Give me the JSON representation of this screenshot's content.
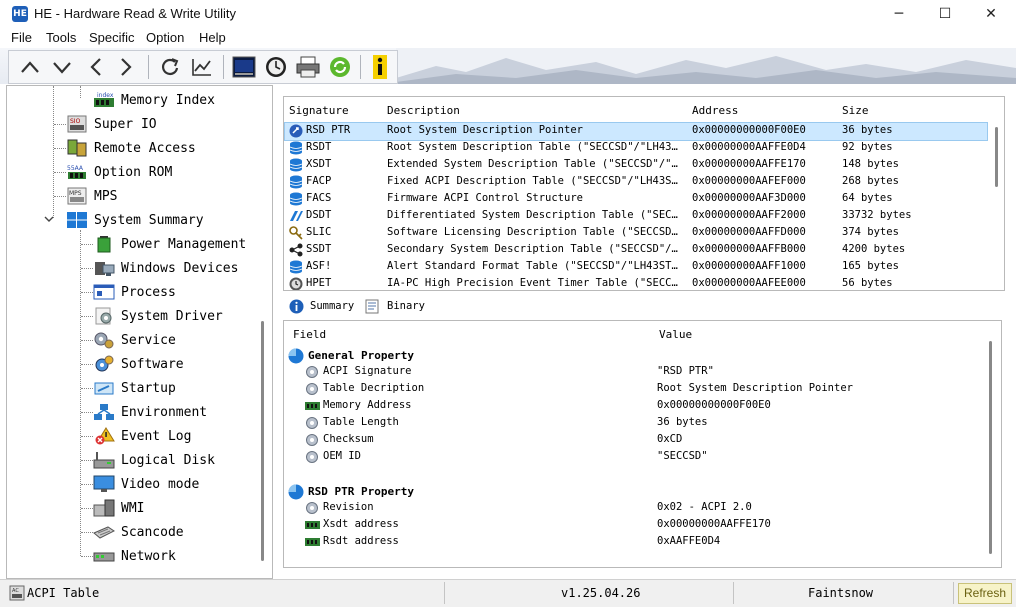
{
  "window": {
    "title": "HE - Hardware Read & Write Utility",
    "app_icon_text": "HE",
    "controls": [
      "─",
      "☐",
      "✕"
    ]
  },
  "menu": [
    "File",
    "Tools",
    "Specific",
    "Option",
    "Help"
  ],
  "toolbar": {
    "buttons": [
      "up-icon",
      "down-icon",
      "back-icon",
      "forward-icon",
      "refresh-icon",
      "chart-icon",
      "terminal-icon",
      "clock-icon",
      "printer-icon",
      "recycle-icon",
      "info-icon"
    ]
  },
  "tree": {
    "items": [
      {
        "label": "Memory Index",
        "icon": "memory-index-icon",
        "icon_text": "index"
      },
      {
        "label": "Super IO",
        "icon": "sio-icon",
        "icon_text": "SIO"
      },
      {
        "label": "Remote Access",
        "icon": "remote-access-icon"
      },
      {
        "label": "Option ROM",
        "icon": "rom-icon",
        "icon_text": "55AA"
      },
      {
        "label": "MPS",
        "icon": "mps-icon",
        "icon_text": "MPS"
      },
      {
        "label": "System Summary",
        "icon": "windows-icon"
      },
      {
        "label": "Power Management",
        "icon": "battery-icon"
      },
      {
        "label": "Windows Devices",
        "icon": "devices-icon"
      },
      {
        "label": "Process",
        "icon": "process-icon"
      },
      {
        "label": "System Driver",
        "icon": "driver-icon"
      },
      {
        "label": "Service",
        "icon": "service-icon"
      },
      {
        "label": "Software",
        "icon": "software-icon"
      },
      {
        "label": "Startup",
        "icon": "startup-icon"
      },
      {
        "label": "Environment",
        "icon": "environment-icon"
      },
      {
        "label": "Event Log",
        "icon": "event-log-icon"
      },
      {
        "label": "Logical Disk",
        "icon": "disk-icon"
      },
      {
        "label": "Video mode",
        "icon": "monitor-icon"
      },
      {
        "label": "WMI",
        "icon": "wmi-icon"
      },
      {
        "label": "Scancode",
        "icon": "keyboard-icon"
      },
      {
        "label": "Network",
        "icon": "network-icon"
      }
    ]
  },
  "acpi": {
    "columns": [
      "Signature",
      "Description",
      "Address",
      "Size"
    ],
    "rows": [
      {
        "sig": "RSD PTR",
        "desc": "Root System Description Pointer",
        "addr": "0x00000000000F00E0",
        "size": "36 bytes",
        "icon": "rsdptr-icon"
      },
      {
        "sig": "RSDT",
        "desc": "Root System Description Table (\"SECCSD\"/\"LH43…",
        "addr": "0x00000000AAFFE0D4",
        "size": "92 bytes",
        "icon": "database-icon"
      },
      {
        "sig": "XSDT",
        "desc": "Extended System Description Table (\"SECCSD\"/\"…",
        "addr": "0x00000000AAFFE170",
        "size": "148 bytes",
        "icon": "database-icon"
      },
      {
        "sig": "FACP",
        "desc": "Fixed ACPI Description Table (\"SECCSD\"/\"LH43S…",
        "addr": "0x00000000AAFEF000",
        "size": "268 bytes",
        "icon": "database-icon"
      },
      {
        "sig": "FACS",
        "desc": "Firmware ACPI Control Structure",
        "addr": "0x00000000AAF3D000",
        "size": "64 bytes",
        "icon": "database-icon"
      },
      {
        "sig": "DSDT",
        "desc": "Differentiated System Description Table (\"SEC…",
        "addr": "0x00000000AAFF2000",
        "size": "33732 bytes",
        "icon": "dsdt-icon"
      },
      {
        "sig": "SLIC",
        "desc": "Software Licensing Description Table (\"SECCSD…",
        "addr": "0x00000000AAFFD000",
        "size": "374 bytes",
        "icon": "key-icon"
      },
      {
        "sig": "SSDT",
        "desc": "Secondary System Description Table (\"SECCSD\"/…",
        "addr": "0x00000000AAFFB000",
        "size": "4200 bytes",
        "icon": "ssdt-icon"
      },
      {
        "sig": "ASF!",
        "desc": "Alert Standard Format Table (\"SECCSD\"/\"LH43ST…",
        "addr": "0x00000000AAFF1000",
        "size": "165 bytes",
        "icon": "database-icon"
      },
      {
        "sig": "HPET",
        "desc": "IA-PC High Precision Event Timer Table (\"SECC…",
        "addr": "0x00000000AAFEE000",
        "size": "56 bytes",
        "icon": "timer-icon"
      }
    ]
  },
  "tabs": [
    {
      "label": "Summary",
      "icon": "info-icon"
    },
    {
      "label": "Binary",
      "icon": "binary-icon"
    }
  ],
  "detail": {
    "columns": [
      "Field",
      "Value"
    ],
    "groups": [
      {
        "title": "General Property",
        "rows": [
          {
            "field": "ACPI Signature",
            "value": "\"RSD PTR\"",
            "icon": "gear-icon"
          },
          {
            "field": "Table Decription",
            "value": "Root System Description Pointer",
            "icon": "gear-icon"
          },
          {
            "field": "Memory Address",
            "value": "0x00000000000F00E0",
            "icon": "memory-chip-icon"
          },
          {
            "field": "Table Length",
            "value": "36 bytes",
            "icon": "gear-icon"
          },
          {
            "field": "Checksum",
            "value": "0xCD",
            "icon": "gear-icon"
          },
          {
            "field": "OEM ID",
            "value": "\"SECCSD\"",
            "icon": "gear-icon"
          }
        ]
      },
      {
        "title": "RSD PTR Property",
        "rows": [
          {
            "field": "Revision",
            "value": "0x02 - ACPI 2.0",
            "icon": "gear-icon"
          },
          {
            "field": "Xsdt address",
            "value": "0x00000000AAFFE170",
            "icon": "memory-chip-icon"
          },
          {
            "field": "Rsdt address",
            "value": "0xAAFFE0D4",
            "icon": "memory-chip-icon"
          }
        ]
      }
    ]
  },
  "status": {
    "left": "ACPI Table",
    "version": "v1.25.04.26",
    "author": "Faintsnow",
    "refresh_label": "Refresh"
  },
  "colors": {
    "selection": "#cce8ff",
    "accent_blue": "#1e78d4",
    "refresh_bg": "#f7f3c8"
  }
}
